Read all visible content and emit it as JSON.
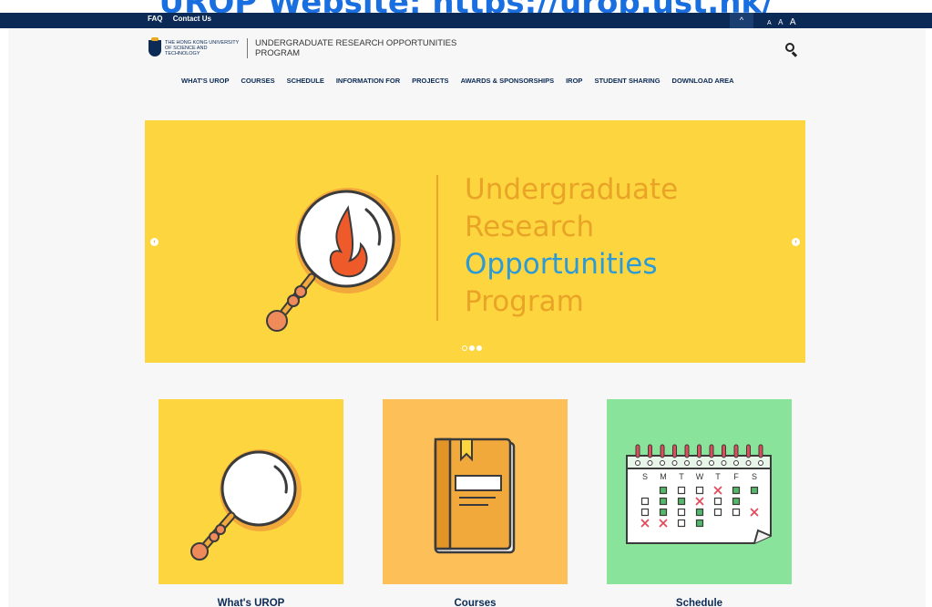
{
  "overlay": {
    "prefix": "UROP Website: ",
    "link": "https://urop.ust.hk/"
  },
  "topbar": {
    "links": [
      "FAQ",
      "Contact Us"
    ],
    "toggle_glyph": "^",
    "sizes": [
      "A",
      "A",
      "A"
    ]
  },
  "header": {
    "university": "THE HONG KONG UNIVERSITY OF SCIENCE AND TECHNOLOGY",
    "program": "UNDERGRADUATE RESEARCH OPPORTUNITIES PROGRAM"
  },
  "nav": [
    "WHAT'S UROP",
    "COURSES",
    "SCHEDULE",
    "INFORMATION FOR",
    "PROJECTS",
    "AWARDS & SPONSORSHIPS",
    "IROP",
    "STUDENT SHARING",
    "DOWNLOAD AREA"
  ],
  "hero": {
    "lines": [
      "Undergraduate",
      "Research",
      "Opportunities",
      "Program"
    ],
    "prev_glyph": "‹",
    "next_glyph": "›",
    "slide_count": 3,
    "active_slide": 2
  },
  "cards": [
    {
      "title": "What's UROP",
      "color": "#fdd53f"
    },
    {
      "title": "Courses",
      "color": "#fdbf57"
    },
    {
      "title": "Schedule",
      "color": "#8ae39b"
    }
  ],
  "calendar": {
    "days": [
      "S",
      "M",
      "T",
      "W",
      "T",
      "F",
      "S"
    ]
  },
  "colors": {
    "navy": "#0b2a55",
    "accent_orange": "#e9a427",
    "accent_blue": "#2c9ad7"
  }
}
